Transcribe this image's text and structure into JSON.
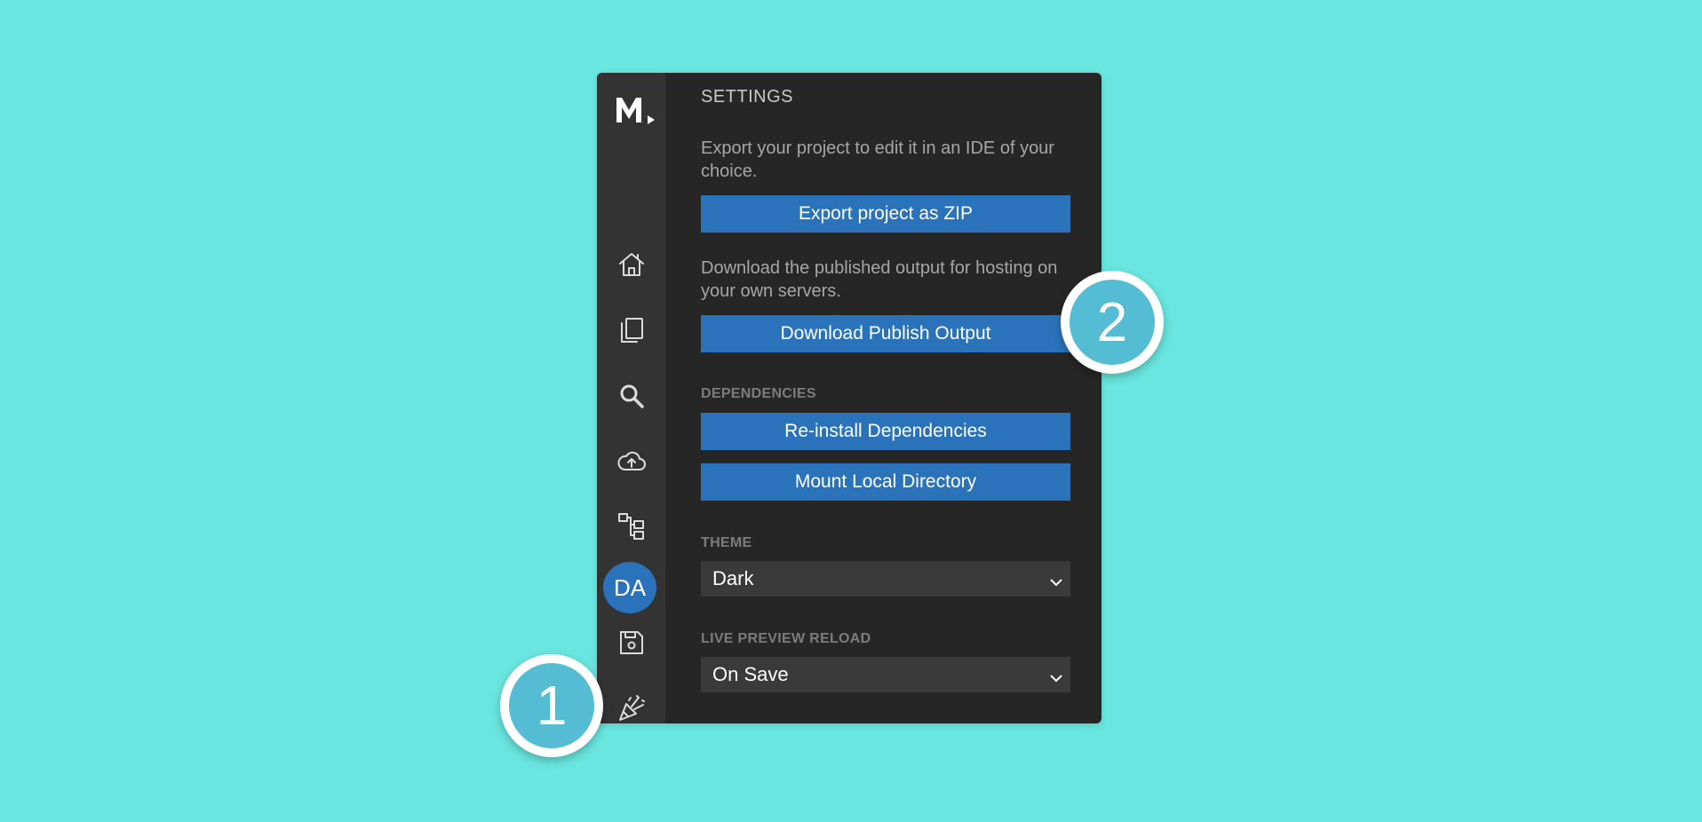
{
  "sidebar": {
    "logo_text": "M.",
    "avatar_initials": "DA",
    "icons": {
      "home": "home-icon",
      "pages": "pages-icon",
      "search": "search-icon",
      "publish": "cloud-upload-icon",
      "sitemap": "sitemap-icon",
      "save": "save-icon",
      "celebrate": "party-popper-icon",
      "settings": "gear-icon"
    }
  },
  "settings": {
    "title": "SETTINGS",
    "export_desc": "Export your project to edit it in an IDE of your choice.",
    "export_button": "Export project as ZIP",
    "download_desc": "Download the published output for hosting on your own servers.",
    "download_button": "Download Publish Output",
    "dependencies_label": "DEPENDENCIES",
    "reinstall_button": "Re-install Dependencies",
    "mount_button": "Mount Local Directory",
    "theme_label": "THEME",
    "theme_value": "Dark",
    "reload_label": "LIVE PREVIEW RELOAD",
    "reload_value": "On Save"
  },
  "callouts": {
    "one": "1",
    "two": "2"
  },
  "colors": {
    "background": "#69e6df",
    "panel": "#262626",
    "sidebar": "#333333",
    "accent": "#2a73bb",
    "callout": "#55bdd3"
  }
}
